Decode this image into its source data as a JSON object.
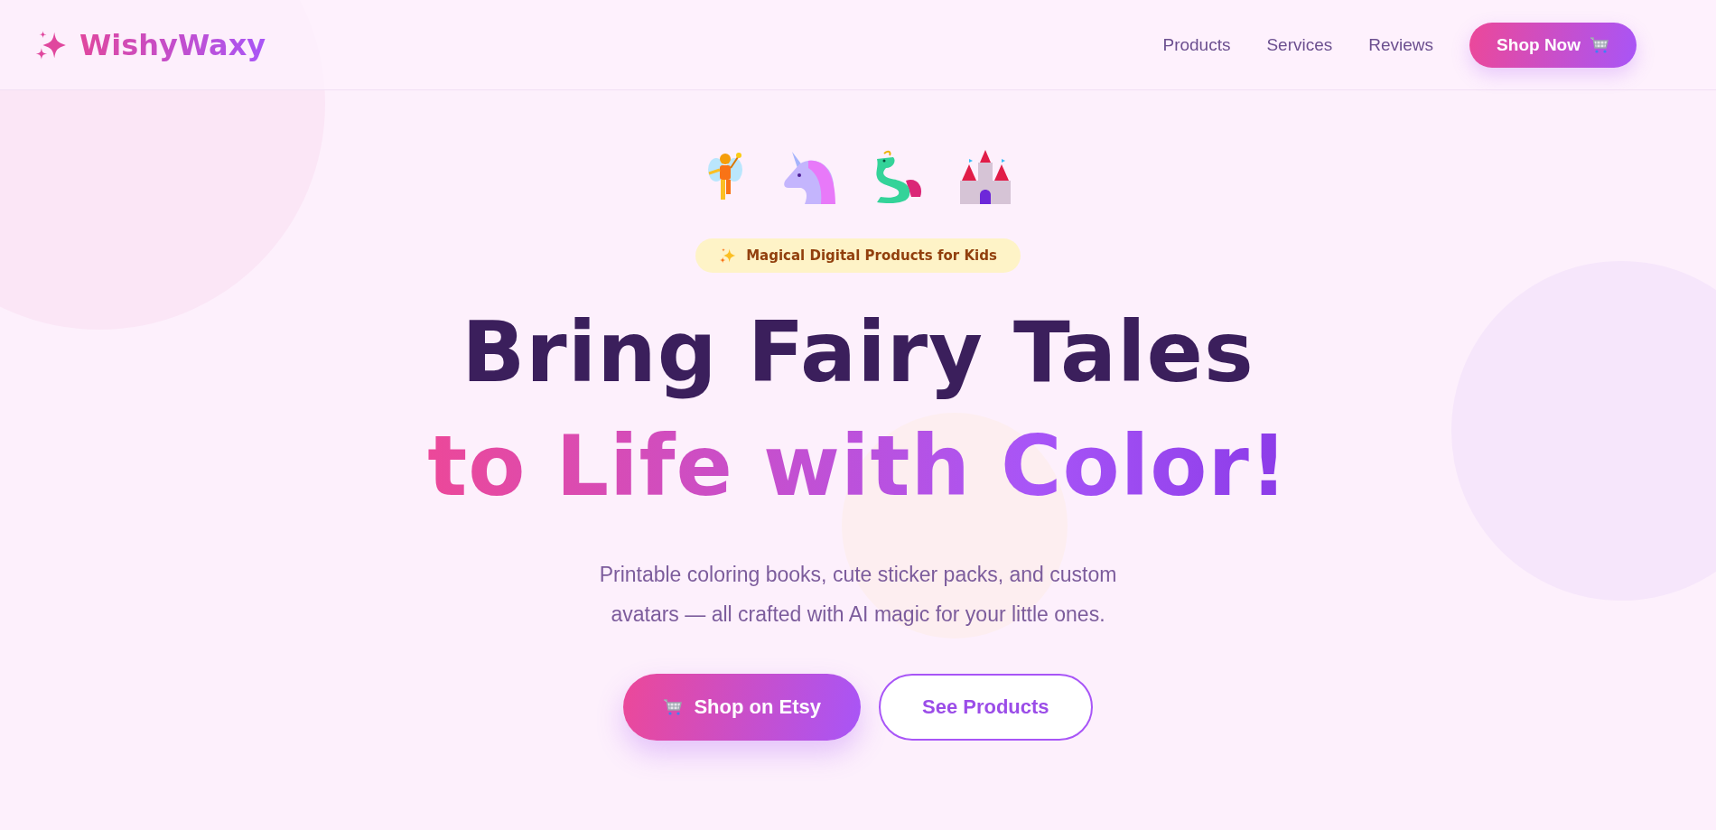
{
  "header": {
    "logo": "WishyWaxy",
    "links": [
      "Products",
      "Services",
      "Reviews"
    ],
    "cta": "Shop Now"
  },
  "hero": {
    "badge": "Magical Digital Products for Kids",
    "title": [
      "Bring Fairy Tales",
      "to Life with Color!"
    ],
    "subtitle": "Printable coloring books, cute sticker packs, and custom avatars — all crafted with AI magic for your little ones.",
    "buttons": [
      {
        "label": "Shop on Etsy",
        "kind": "primary"
      },
      {
        "label": "See Products",
        "kind": "outline"
      }
    ]
  }
}
